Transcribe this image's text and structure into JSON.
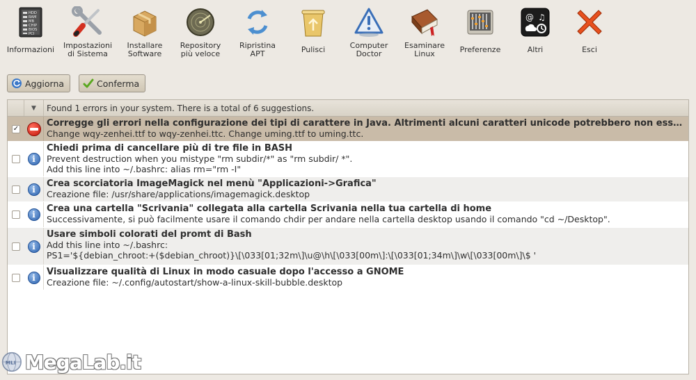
{
  "toolbar": {
    "items": [
      {
        "label": "Informazioni",
        "icon": "computer-tower-icon"
      },
      {
        "label": "Impostazioni\ndi Sistema",
        "icon": "wrench-screwdriver-icon"
      },
      {
        "label": "Installare\nSoftware",
        "icon": "package-box-icon"
      },
      {
        "label": "Repository\npiù veloce",
        "icon": "radar-icon"
      },
      {
        "label": "Ripristina\nAPT",
        "icon": "refresh-arrows-icon"
      },
      {
        "label": "Pulisci",
        "icon": "trash-can-icon"
      },
      {
        "label": "Computer\nDoctor",
        "icon": "warning-triangle-icon"
      },
      {
        "label": "Esaminare\nLinux",
        "icon": "book-icon"
      },
      {
        "label": "Preferenze",
        "icon": "sliders-icon"
      },
      {
        "label": "Altri",
        "icon": "widgets-icon"
      },
      {
        "label": "Esci",
        "icon": "close-x-icon"
      }
    ],
    "hdd_labels": [
      "HDD",
      "RAM",
      "MB",
      "CHIP",
      "BIOS",
      "PCI"
    ]
  },
  "actions": {
    "refresh_label": "Aggiorna",
    "confirm_label": "Conferma"
  },
  "list": {
    "header": "Found 1 errors in your system. There is a total of 6 suggestions.",
    "sort_glyph": "▼",
    "rows": [
      {
        "checked": true,
        "type": "error",
        "title": "Corregge gli errori nella configurazione dei tipi di carattere in Java. Altrimenti alcuni caratteri unicode potrebbero non essere visualizzati",
        "lines": [
          "Change wqy-zenhei.ttf to wqy-zenhei.ttc. Change uming.ttf to uming.ttc."
        ]
      },
      {
        "checked": false,
        "type": "info",
        "title": "Chiedi prima di cancellare più di tre file in BASH",
        "lines": [
          "Prevent destruction when you mistype \"rm subdir/*\" as \"rm subdir/ *\".",
          "Add this line into ~/.bashrc: alias rm=\"rm -I\""
        ]
      },
      {
        "checked": false,
        "type": "info",
        "title": "Crea scorciatoria ImageMagick nel menù \"Applicazioni->Grafica\"",
        "lines": [
          "Creazione file: /usr/share/applications/imagemagick.desktop"
        ]
      },
      {
        "checked": false,
        "type": "info",
        "title": "Crea una cartella \"Scrivania\" collegata alla cartella Scrivania nella tua cartella di home",
        "lines": [
          "Successivamente, si può facilmente usare il comando chdir per andare nella cartella desktop usando il comando \"cd ~/Desktop\"."
        ]
      },
      {
        "checked": false,
        "type": "info",
        "title": "Usare simboli colorati del promt di Bash",
        "lines": [
          "Add this line into ~/.bashrc:",
          "PS1='${debian_chroot:+($debian_chroot)}\\[\\033[01;32m\\]\\u@\\h\\[\\033[00m\\]:\\[\\033[01;34m\\]\\w\\[\\033[00m\\]\\$ '"
        ]
      },
      {
        "checked": false,
        "type": "info",
        "title": "Visualizzare qualità di Linux in modo casuale dopo l'accesso a GNOME",
        "lines": [
          "Creazione file: ~/.config/autostart/show-a-linux-skill-bubble.desktop"
        ]
      }
    ]
  },
  "watermark": {
    "text": "MegaLab.it",
    "badge": "MLI"
  },
  "colors": {
    "background": "#ede9e3",
    "selected_row": "#c9bba8",
    "alt_row": "#efeeec",
    "info_blue": "#2e64b0",
    "error_red": "#c4160b"
  }
}
